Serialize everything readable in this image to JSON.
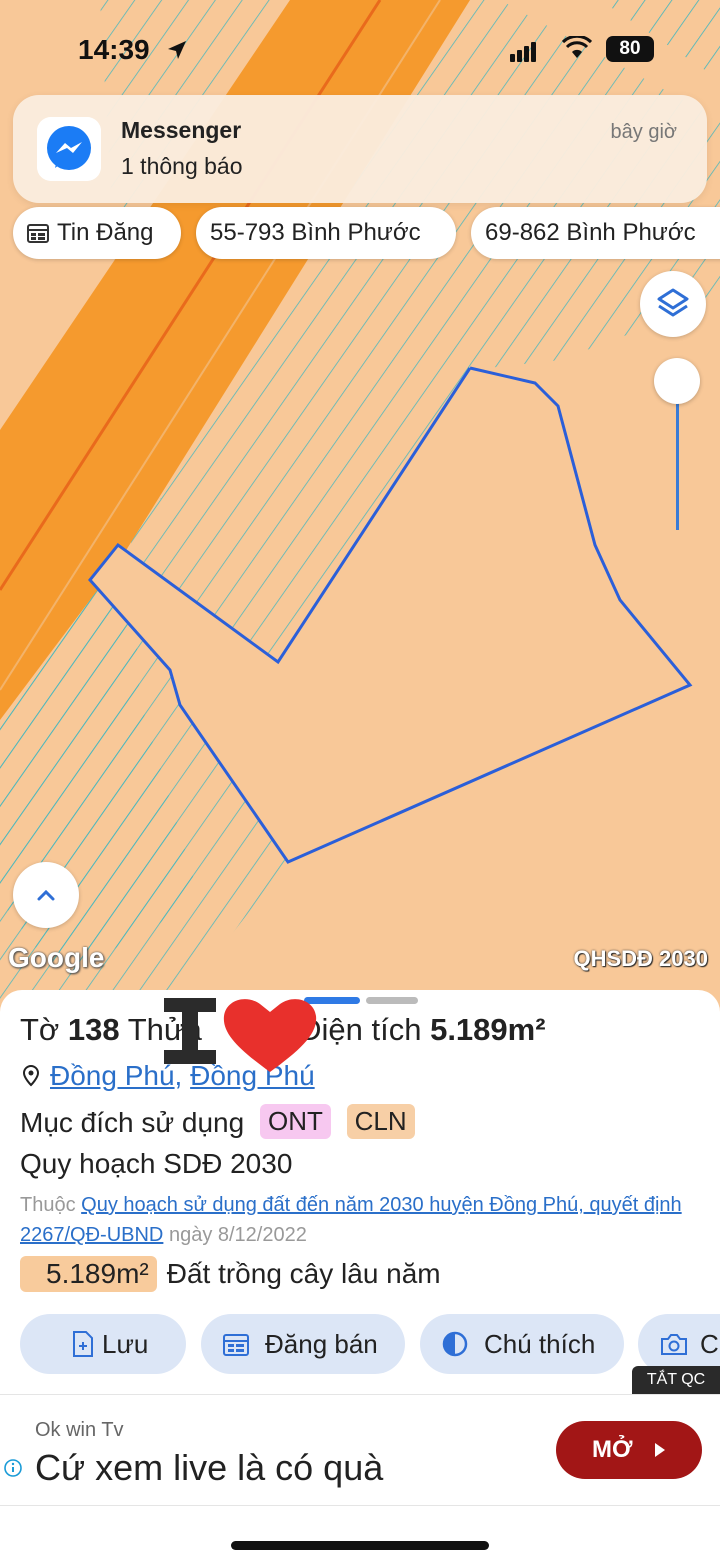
{
  "status_bar": {
    "time": "14:39",
    "battery": "80"
  },
  "notification": {
    "app": "Messenger",
    "message": "1 thông báo",
    "time": "bây giờ"
  },
  "chips": [
    {
      "label": "Tin Đăng"
    },
    {
      "label": "55-793 Bình Phước"
    },
    {
      "label": "69-862 Bình Phước"
    }
  ],
  "map": {
    "attribution": "Google",
    "layer_label": "QHSDĐ 2030"
  },
  "parcel": {
    "sheet_prefix": "Tờ",
    "sheet_no": "138",
    "plot_prefix": "Thửa",
    "area_prefix": "Diện tích",
    "area": "5.189m²",
    "location_1": "Đồng Phú",
    "location_2": "Đồng Phú",
    "purpose_label": "Mục đích sử dụng",
    "purpose_tags": [
      "ONT",
      "CLN"
    ],
    "planning_title": "Quy hoạch SDĐ 2030",
    "source_prefix": "Thuộc",
    "source_link": "Quy hoạch sử dụng đất đến năm 2030 huyện Đồng Phú, quyết định 2267/QĐ-UBND",
    "source_date": "ngày 8/12/2022",
    "landuse_area": "5.189m²",
    "landuse_type": "Đất trồng cây lâu năm"
  },
  "actions": [
    {
      "label": "Lưu"
    },
    {
      "label": "Đăng bán"
    },
    {
      "label": "Chú thích"
    },
    {
      "label": "C"
    }
  ],
  "ad": {
    "close_label": "TẮT QC",
    "sponsor": "Ok win Tv",
    "headline": "Cứ xem live là có quà",
    "cta": "MỞ"
  },
  "colors": {
    "accent": "#2f7ae5",
    "parcel_border": "#2b5fd9",
    "road": "#f59a2e",
    "land": "#f8c898",
    "cta": "#a21616"
  }
}
